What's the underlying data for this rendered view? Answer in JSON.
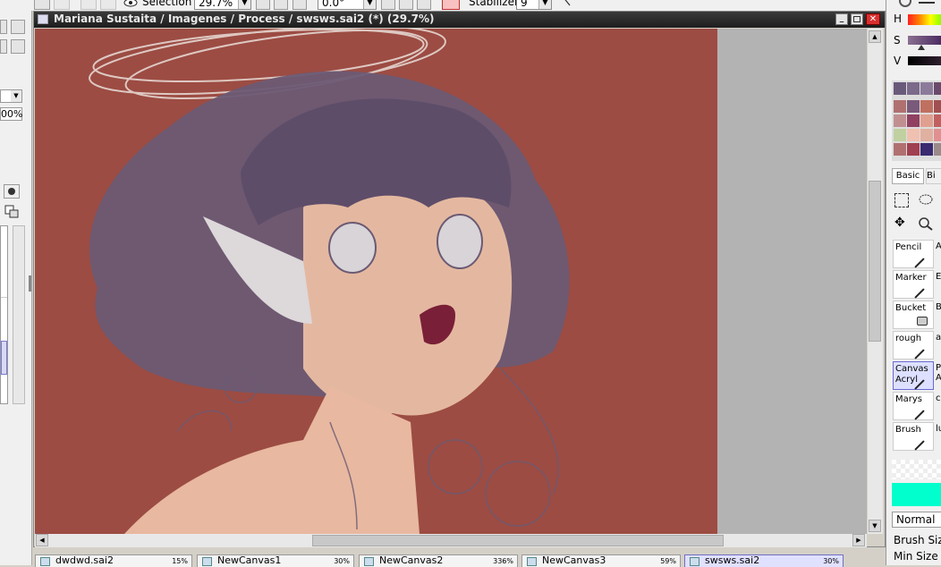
{
  "toolbar": {
    "selection_label": "Selection",
    "zoom_value": "29.7%",
    "rotation_value": "0.0°",
    "stabilizer_label": "Stabilizer",
    "stabilizer_value": "9"
  },
  "left_panel": {
    "opacity_value": "00%"
  },
  "document": {
    "title": "Mariana Sustaita / Imagenes / Process / swsws.sai2 (*) (29.7%)"
  },
  "tabs": [
    {
      "name": "dwdwd.sai2",
      "zoom": "15%"
    },
    {
      "name": "NewCanvas1",
      "zoom": "30%"
    },
    {
      "name": "NewCanvas2",
      "zoom": "336%"
    },
    {
      "name": "NewCanvas3",
      "zoom": "59%"
    },
    {
      "name": "swsws.sai2",
      "zoom": "30%"
    }
  ],
  "color_panel": {
    "h_label": "H",
    "s_label": "S",
    "v_label": "V",
    "swatches": [
      "#6a5a7a",
      "#7b6a8a",
      "#8c7a9a",
      "#6a4a6a",
      "#b07070",
      "#7a5a7a",
      "#c07060",
      "#a05050",
      "#c09090",
      "#904060",
      "#e0a090",
      "#c06060",
      "#c0d0a0",
      "#f0c0b0",
      "#e0b0a0",
      "#e09090",
      "#b07070",
      "#a04050",
      "#3a2a70",
      "#9a8a8a"
    ]
  },
  "tools_panel": {
    "tab_basic": "Basic",
    "tab_other": "Bi",
    "tools": [
      {
        "label": "Pencil",
        "side": "A"
      },
      {
        "label": "Marker",
        "side": "E"
      },
      {
        "label": "Bucket",
        "side": "B"
      },
      {
        "label": "rough",
        "side": "a"
      },
      {
        "label": "Canvas Acryl",
        "side": "P A"
      },
      {
        "label": "Marys",
        "side": "c"
      },
      {
        "label": "Brush",
        "side": "lu"
      }
    ],
    "blend_mode": "Normal",
    "brush_size_label": "Brush Size",
    "min_size_label": "Min Size"
  },
  "colors": {
    "canvas_bg": "#9c4c43",
    "hair": "#6b5a74",
    "skin": "#e4b8a0",
    "current_color": "#00ffcc"
  }
}
